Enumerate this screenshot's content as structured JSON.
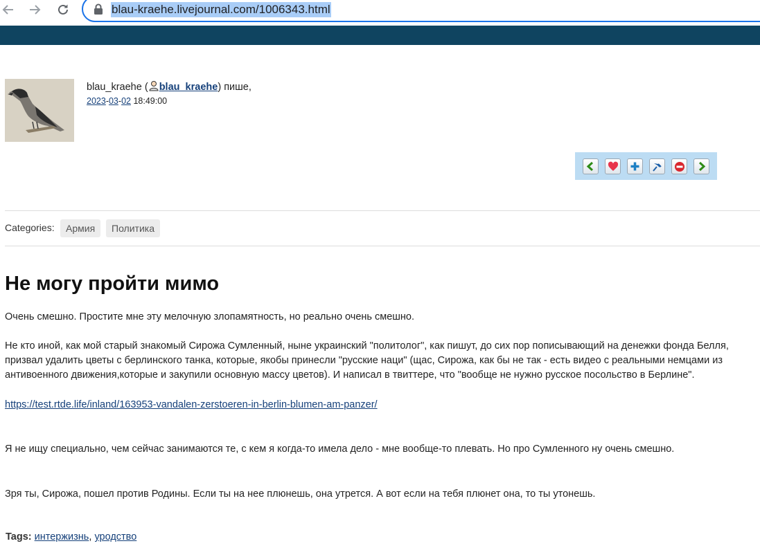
{
  "browser": {
    "url": "blau-kraehe.livejournal.com/1006343.html"
  },
  "author": {
    "name": "blau_kraehe",
    "user_link": "blau_kraehe",
    "verb": "пише,",
    "date_year": "2023",
    "date_month": "03",
    "date_day": "02",
    "time": "18:49:00"
  },
  "actions": [
    "chevron-left-icon",
    "heart-icon",
    "plus-icon",
    "pin-icon",
    "minus-circle-icon",
    "chevron-right-icon"
  ],
  "categories": {
    "label": "Categories:",
    "items": [
      "Армия",
      "Политика"
    ]
  },
  "post": {
    "title": "Не могу пройти мимо",
    "p1": "Очень смешно. Простите мне эту мелочную злопамятность, но реально очень смешно.",
    "p2_line1": "Не кто иной, как мой старый знакомый Сирожа Сумленный, ныне украинский \"политолог\", как пишут, до сих пор пописывающий на денежки фонда Белля,",
    "p2_line2": "призвал удалить цветы с берлинского танка, которые, якобы принесли \"русские наци\" (щас, Сирожа, как бы не так - есть видео с реальными немцами из",
    "p2_line3": "антивоенного движения,которые и закупили основную массу цветов).  И написал в твиттере, что \"вообще не нужно русское посольство в Берлине\".",
    "link": "https://test.rtde.life/inland/163953-vandalen-zerstoeren-in-berlin-blumen-am-panzer/",
    "p3": "Я не ищу специально, чем сейчас занимаются те, с кем я когда-то имела дело - мне вообще-то плевать. Но про Сумленного ну очень смешно.",
    "p4": "Зря ты, Сирожа, пошел против Родины. Если ты на нее плюнешь, она утрется. А вот если на тебя плюнет она, то ты утонешь."
  },
  "tags": {
    "label": "Tags:",
    "items": [
      "интержизнь",
      "уродство"
    ]
  }
}
